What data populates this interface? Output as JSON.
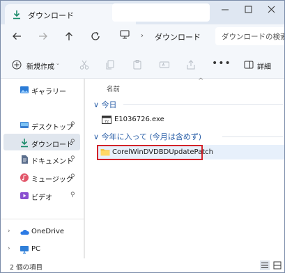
{
  "tab": {
    "title": "ダウンロード",
    "icon": "download-folder-icon"
  },
  "window_controls": {
    "minimize": "─",
    "maximize": "☐",
    "close": "✕"
  },
  "nav": {
    "back_icon": "back-arrow-icon",
    "forward_icon": "forward-arrow-icon",
    "up_icon": "up-arrow-icon",
    "refresh_icon": "refresh-icon"
  },
  "address": {
    "location_icon": "this-pc-icon",
    "chevron": "›",
    "path": "ダウンロード"
  },
  "search": {
    "placeholder": "ダウンロードの検索"
  },
  "toolbar": {
    "new_label": "新規作成",
    "new_chevron": "⌄",
    "more": "•••",
    "details_label": "詳細",
    "icons": [
      "cut-icon",
      "copy-icon",
      "paste-icon",
      "rename-icon",
      "share-icon",
      "delete-icon",
      "more-icon",
      "details-pane-icon"
    ]
  },
  "sidebar": {
    "items": [
      {
        "label": "ギャラリー",
        "icon": "gallery-icon",
        "pinned": false
      },
      {
        "label": "デスクトップ",
        "icon": "desktop-icon",
        "pinned": true
      },
      {
        "label": "ダウンロード",
        "icon": "download-icon",
        "pinned": true,
        "selected": true
      },
      {
        "label": "ドキュメント",
        "icon": "documents-icon",
        "pinned": true
      },
      {
        "label": "ミュージック",
        "icon": "music-icon",
        "pinned": true
      },
      {
        "label": "ビデオ",
        "icon": "videos-icon",
        "pinned": true
      },
      {
        "label": "OneDrive",
        "icon": "onedrive-icon",
        "expandable": true
      },
      {
        "label": "PC",
        "icon": "pc-icon",
        "expandable": true
      }
    ],
    "pin_glyph": "📌",
    "expand_glyph": "›"
  },
  "content": {
    "column_header": "名前",
    "sort_glyph": "^",
    "groups": [
      {
        "label": "今日",
        "chevron": "∨",
        "files": [
          {
            "name": "E1036726.exe",
            "icon": "exe-file-icon"
          }
        ]
      },
      {
        "label": "今年に入って (今月は含めず)",
        "chevron": "∨",
        "files": [
          {
            "name": "CorelWinDVDBDUpdatePatch",
            "icon": "folder-icon",
            "selected": true
          }
        ]
      }
    ]
  },
  "status_bar": {
    "item_count": "2 個の項目",
    "view_icons": [
      "details-view-icon",
      "tiles-view-icon"
    ]
  },
  "colors": {
    "accent": "#2a5fa8",
    "highlight_box": "#d3232a",
    "folder": "#f5c342",
    "selection": "#e7f0fb"
  }
}
